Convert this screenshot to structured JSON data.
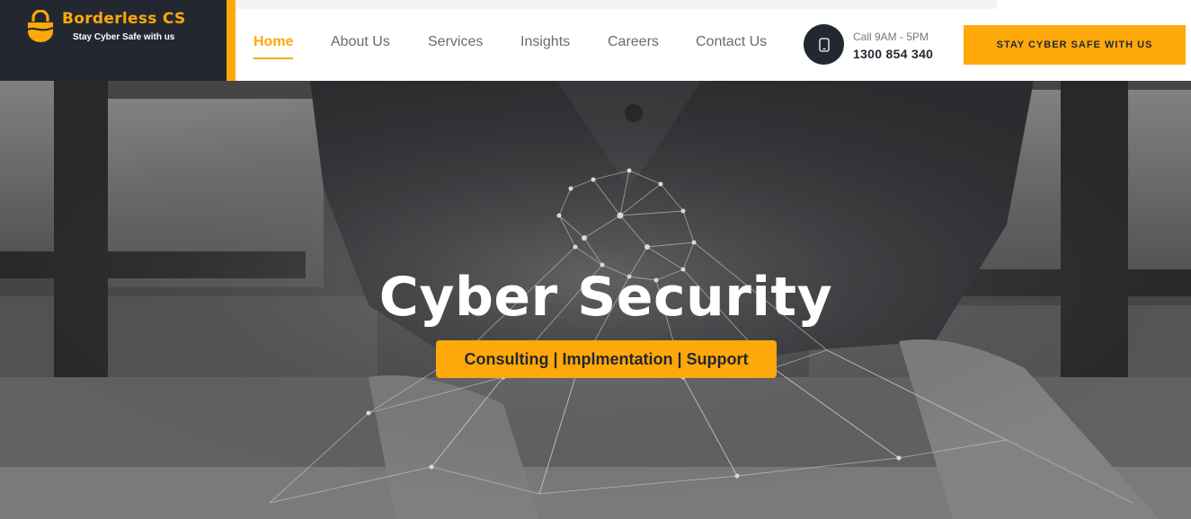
{
  "brand": {
    "name": "Borderless CS",
    "tagline": "Stay Cyber Safe with us",
    "logo_icon": "shield-wave-icon"
  },
  "nav": {
    "items": [
      {
        "label": "Home",
        "active": true
      },
      {
        "label": "About Us",
        "active": false
      },
      {
        "label": "Services",
        "active": false
      },
      {
        "label": "Insights",
        "active": false
      },
      {
        "label": "Careers",
        "active": false
      },
      {
        "label": "Contact Us",
        "active": false
      }
    ]
  },
  "contact": {
    "icon": "phone-icon",
    "hours": "Call 9AM - 5PM",
    "phone": "1300 854 340"
  },
  "cta": {
    "label": "STAY CYBER SAFE WITH US"
  },
  "hero": {
    "title": "Cyber Security",
    "subtitle": "Consulting | Implmentation | Support"
  },
  "colors": {
    "accent": "#ffa80a",
    "dark": "#232830",
    "nav_text": "#6b6b6b"
  }
}
